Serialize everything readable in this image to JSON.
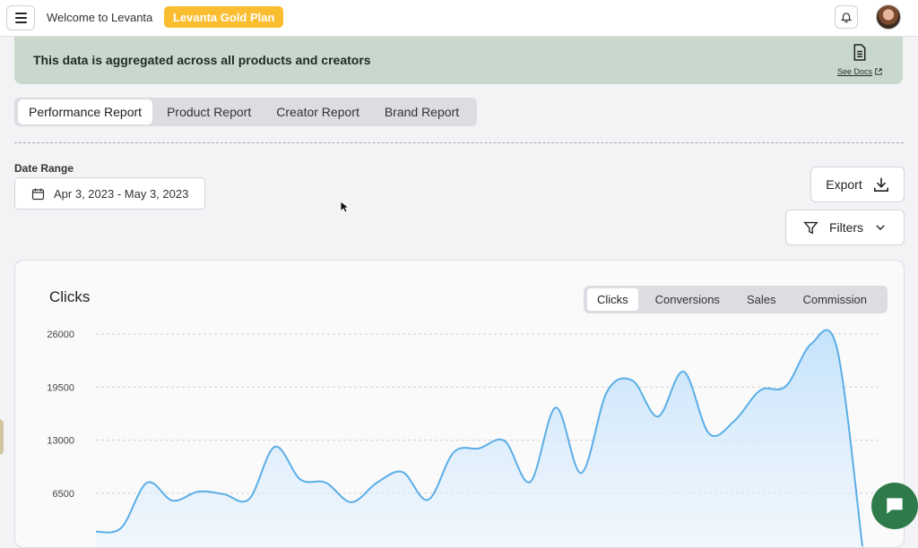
{
  "header": {
    "welcome_text": "Welcome to Levanta",
    "plan_badge": "Levanta Gold Plan",
    "icons": {
      "menu": "hamburger-icon",
      "notifications": "bell-icon",
      "avatar": "user-avatar"
    }
  },
  "notice": {
    "text": "This data is aggregated across all products and creators",
    "docs_label": "See Docs",
    "icons": {
      "docs": "document-icon",
      "external": "external-link-icon"
    }
  },
  "report_tabs": [
    {
      "label": "Performance Report",
      "active": true
    },
    {
      "label": "Product Report",
      "active": false
    },
    {
      "label": "Creator Report",
      "active": false
    },
    {
      "label": "Brand Report",
      "active": false
    }
  ],
  "date_range": {
    "label": "Date Range",
    "value": "Apr 3, 2023 - May 3, 2023"
  },
  "actions": {
    "export_label": "Export",
    "filters_label": "Filters"
  },
  "chart_card": {
    "title": "Clicks",
    "metric_tabs": [
      {
        "label": "Clicks",
        "active": true
      },
      {
        "label": "Conversions",
        "active": false
      },
      {
        "label": "Sales",
        "active": false
      },
      {
        "label": "Commission",
        "active": false
      }
    ]
  },
  "chart_data": {
    "type": "area",
    "title": "Clicks",
    "y_ticks": [
      "26000",
      "19500",
      "13000",
      "6500"
    ],
    "ylim": [
      0,
      26000
    ],
    "grid": true,
    "color": "#5aaee6",
    "values": [
      1800,
      2300,
      7800,
      5600,
      6700,
      6400,
      5800,
      12200,
      8200,
      7800,
      5400,
      7800,
      9100,
      5700,
      11500,
      12000,
      12900,
      7900,
      17000,
      9000,
      18900,
      20300,
      15900,
      21400,
      13800,
      15400,
      19100,
      19600,
      24800,
      24300,
      0
    ]
  }
}
